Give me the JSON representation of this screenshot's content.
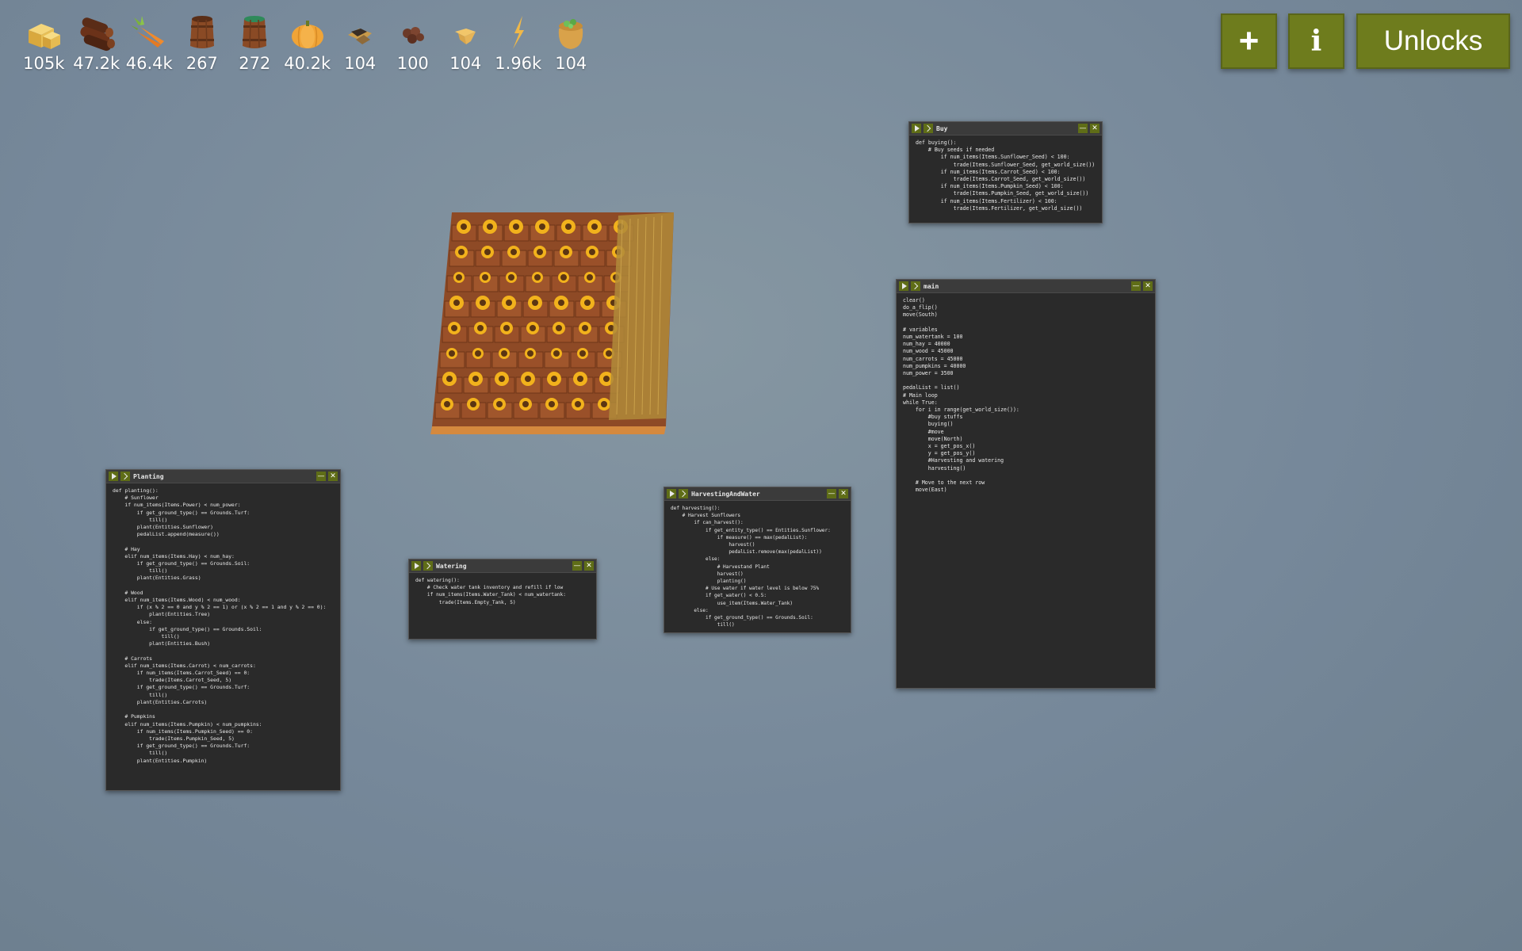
{
  "resources": [
    {
      "icon": "hay-bale-icon",
      "count": "105k"
    },
    {
      "icon": "wood-logs-icon",
      "count": "47.2k"
    },
    {
      "icon": "carrots-icon",
      "count": "46.4k"
    },
    {
      "icon": "empty-tank-icon",
      "count": "267"
    },
    {
      "icon": "water-tank-icon",
      "count": "272"
    },
    {
      "icon": "pumpkin-icon",
      "count": "40.2k"
    },
    {
      "icon": "cactus-seed-icon",
      "count": "104"
    },
    {
      "icon": "bones-icon",
      "count": "100"
    },
    {
      "icon": "weird-substance-icon",
      "count": "104"
    },
    {
      "icon": "power-icon",
      "count": "1.96k"
    },
    {
      "icon": "gold-sack-icon",
      "count": "104"
    }
  ],
  "toolbar": {
    "add_label": "+",
    "info_label": "i",
    "unlocks_label": "Unlocks"
  },
  "windows": {
    "buy": {
      "title": "Buy",
      "code": "def buying():\n    # Buy seeds if needed\n        if num_items(Items.Sunflower_Seed) < 100:\n            trade(Items.Sunflower_Seed, get_world_size())\n        if num_items(Items.Carrot_Seed) < 100:\n            trade(Items.Carrot_Seed, get_world_size())\n        if num_items(Items.Pumpkin_Seed) < 100:\n            trade(Items.Pumpkin_Seed, get_world_size())\n        if num_items(Items.Fertilizer) < 100:\n            trade(Items.Fertilizer, get_world_size())"
    },
    "main": {
      "title": "main",
      "code": "clear()\ndo_a_flip()\nmove(South)\n\n# variables\nnum_watertank = 100\nnum_hay = 40000\nnum_wood = 45000\nnum_carrots = 45000\nnum_pumpkins = 40000\nnum_power = 3500\n\npedalList = list()\n# Main loop\nwhile True:\n    for i in range(get_world_size()):\n        #buy stuffs\n        buying()\n        #move\n        move(North)\n        x = get_pos_x()\n        y = get_pos_y()\n        #Harvesting and watering\n        harvesting()\n\n    # Move to the next row\n    move(East)"
    },
    "planting": {
      "title": "Planting",
      "code": "def planting():\n    # Sunflower\n    if num_items(Items.Power) < num_power:\n        if get_ground_type() == Grounds.Turf:\n            till()\n        plant(Entities.Sunflower)\n        pedalList.append(measure())\n\n    # Hay\n    elif num_items(Items.Hay) < num_hay:\n        if get_ground_type() == Grounds.Soil:\n            till()\n        plant(Entities.Grass)\n\n    # Wood\n    elif num_items(Items.Wood) < num_wood:\n        if (x % 2 == 0 and y % 2 == 1) or (x % 2 == 1 and y % 2 == 0):\n            plant(Entities.Tree)\n        else:\n            if get_ground_type() == Grounds.Soil:\n                till()\n            plant(Entities.Bush)\n\n    # Carrots\n    elif num_items(Items.Carrot) < num_carrots:\n        if num_items(Items.Carrot_Seed) == 0:\n            trade(Items.Carrot_Seed, 5)\n        if get_ground_type() == Grounds.Turf:\n            till()\n        plant(Entities.Carrots)\n\n    # Pumpkins\n    elif num_items(Items.Pumpkin) < num_pumpkins:\n        if num_items(Items.Pumpkin_Seed) == 0:\n            trade(Items.Pumpkin_Seed, 5)\n        if get_ground_type() == Grounds.Turf:\n            till()\n        plant(Entities.Pumpkin)"
    },
    "watering": {
      "title": "Watering",
      "code": "def watering():\n    # Check water tank inventory and refill if low\n    if num_items(Items.Water_Tank) < num_watertank:\n        trade(Items.Empty_Tank, 5)"
    },
    "harvesting": {
      "title": "HarvestingAndWater",
      "code": "def harvesting():\n    # Harvest Sunflowers\n        if can_harvest():\n            if get_entity_type() == Entities.Sunflower:\n                if measure() == max(pedalList):\n                    harvest()\n                    pedalList.remove(max(pedalList))\n            else:\n                # Harvestand Plant\n                harvest()\n                planting()\n            # Use water if water level is below 75%\n            if get_water() < 0.5:\n                use_item(Items.Water_Tank)\n        else:\n            if get_ground_type() == Grounds.Soil:\n                till()"
    }
  },
  "colors": {
    "accent": "#6e7c1d",
    "background": "#76889a",
    "window_bg": "#2a2a2a"
  }
}
